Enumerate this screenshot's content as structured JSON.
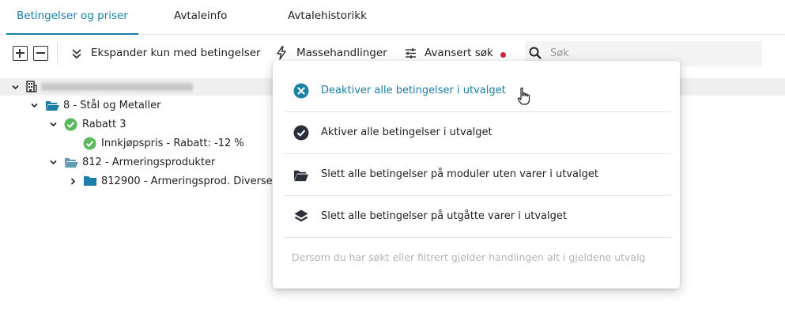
{
  "tabs": [
    {
      "label": "Betingelser og priser",
      "active": true
    },
    {
      "label": "Avtaleinfo",
      "active": false
    },
    {
      "label": "Avtalehistorikk",
      "active": false
    }
  ],
  "toolbar": {
    "expand_all_icon": "plus-square-icon",
    "collapse_all_icon": "minus-square-icon",
    "expand_conditions_label": "Ekspander kun med betingelser",
    "mass_actions_label": "Massehandlinger",
    "advanced_search_label": "Avansert søk",
    "search_placeholder": "Søk",
    "search_value": ""
  },
  "tree": {
    "root": {
      "icon": "building-icon",
      "label_redacted": true
    },
    "nodes": [
      {
        "label": "8 - Stål og Metaller",
        "icon": "folder-open-icon",
        "expanded": true
      },
      {
        "label": "Rabatt 3",
        "icon": "check-circle-icon",
        "expanded": true
      },
      {
        "label": "Innkjøpspris - Rabatt: -12 %",
        "icon": "check-circle-icon"
      },
      {
        "label": "812 - Armeringsprodukter",
        "icon": "folder-open-icon",
        "expanded": true
      },
      {
        "label": "812900 - Armeringsprod. Diverse",
        "icon": "folder-icon",
        "expanded": false
      }
    ]
  },
  "menu": {
    "items": [
      {
        "label": "Deaktiver alle betingelser i utvalget",
        "icon": "x-circle-icon",
        "highlighted": true
      },
      {
        "label": "Aktiver alle betingelser i utvalget",
        "icon": "check-circle-icon",
        "highlighted": false
      },
      {
        "label": "Slett alle betingelser på moduler uten varer i utvalget",
        "icon": "folder-open-icon",
        "highlighted": false
      },
      {
        "label": "Slett alle betingelser på utgåtte varer i utvalget",
        "icon": "layers-icon",
        "highlighted": false
      }
    ],
    "note": "Dersom du har søkt eller filtrert gjelder handlingen alt i gjeldene utvalg"
  },
  "colors": {
    "accent": "#1b7fa6",
    "green": "#5cb85c",
    "folder": "#1b7fa6",
    "red_dot": "#d0253a"
  }
}
